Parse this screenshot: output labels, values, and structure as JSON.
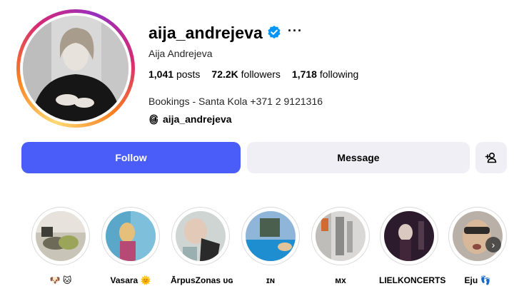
{
  "profile": {
    "username": "aija_andrejeva",
    "full_name": "Aija Andrejeva",
    "verified_icon": "verified-badge-icon",
    "more_label": "···",
    "stats": {
      "posts_count": "1,041",
      "posts_label": "posts",
      "followers_count": "72.2K",
      "followers_label": "followers",
      "following_count": "1,718",
      "following_label": "following"
    },
    "bio": "Bookings - Santa Kola +371 2 9121316",
    "threads_handle": "aija_andrejeva"
  },
  "actions": {
    "follow_label": "Follow",
    "message_label": "Message",
    "add_user_icon": "add-person-icon"
  },
  "highlights": [
    {
      "label": "🐶 🐱"
    },
    {
      "label": "Vasara 🌞"
    },
    {
      "label": "ĀrpusZonas ᴜɢ"
    },
    {
      "label": "ɪɴ"
    },
    {
      "label": "ᴍx"
    },
    {
      "label": "LIELKONCERTS"
    },
    {
      "label": "Eju 👣"
    }
  ],
  "colors": {
    "follow_button": "#4a5df9",
    "secondary_button": "#efeff5",
    "verified": "#0095f6"
  }
}
